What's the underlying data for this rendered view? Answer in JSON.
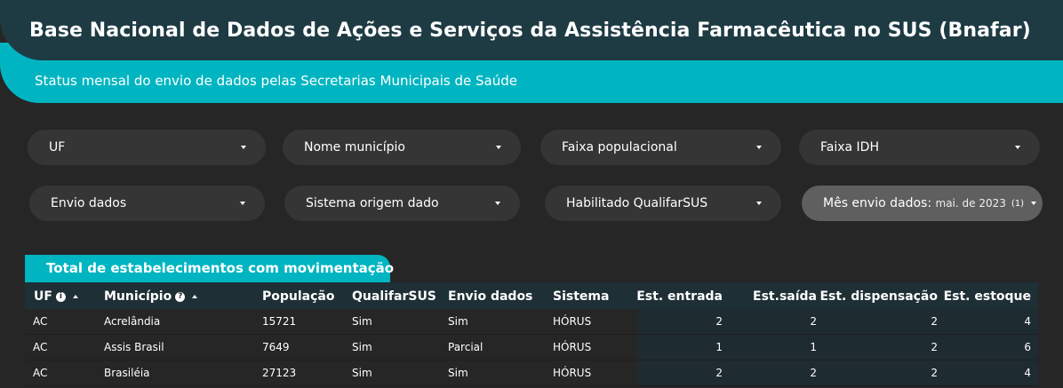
{
  "header": {
    "title": "Base Nacional de Dados de Ações e Serviços da Assistência Farmacêutica no SUS (Bnafar)",
    "subtitle": "Status mensal do envio de dados pelas Secretarias Municipais de Saúde"
  },
  "filters": [
    {
      "label": "UF"
    },
    {
      "label": "Nome município"
    },
    {
      "label": "Faixa populacional"
    },
    {
      "label": "Faixa IDH"
    },
    {
      "label": "Envio dados"
    },
    {
      "label": "Sistema origem dado"
    },
    {
      "label": "Habilitado QualifarSUS"
    },
    {
      "label": "Mês envio dados:",
      "selected": "mai. de 2023",
      "count": "(1)"
    }
  ],
  "table": {
    "title": "Total de estabelecimentos com movimentação",
    "columns": [
      "UF",
      "Município",
      "População",
      "QualifarSUS",
      "Envio dados",
      "Sistema",
      "Est. entrada",
      "Est.saída",
      "Est. dispensação",
      "Est. estoque"
    ],
    "rows": [
      [
        "AC",
        "Acrelândia",
        "15721",
        "Sim",
        "Sim",
        "HÓRUS",
        "2",
        "2",
        "2",
        "4"
      ],
      [
        "AC",
        "Assis Brasil",
        "7649",
        "Sim",
        "Parcial",
        "HÓRUS",
        "1",
        "1",
        "2",
        "6"
      ],
      [
        "AC",
        "Brasiléia",
        "27123",
        "Sim",
        "Sim",
        "HÓRUS",
        "2",
        "2",
        "2",
        "4"
      ]
    ]
  },
  "colors": {
    "accent": "#00b5c1",
    "header_dark": "#1e3b43",
    "background": "#262626",
    "filter_bg": "#353535",
    "filter_active_bg": "#5f5f5f"
  }
}
